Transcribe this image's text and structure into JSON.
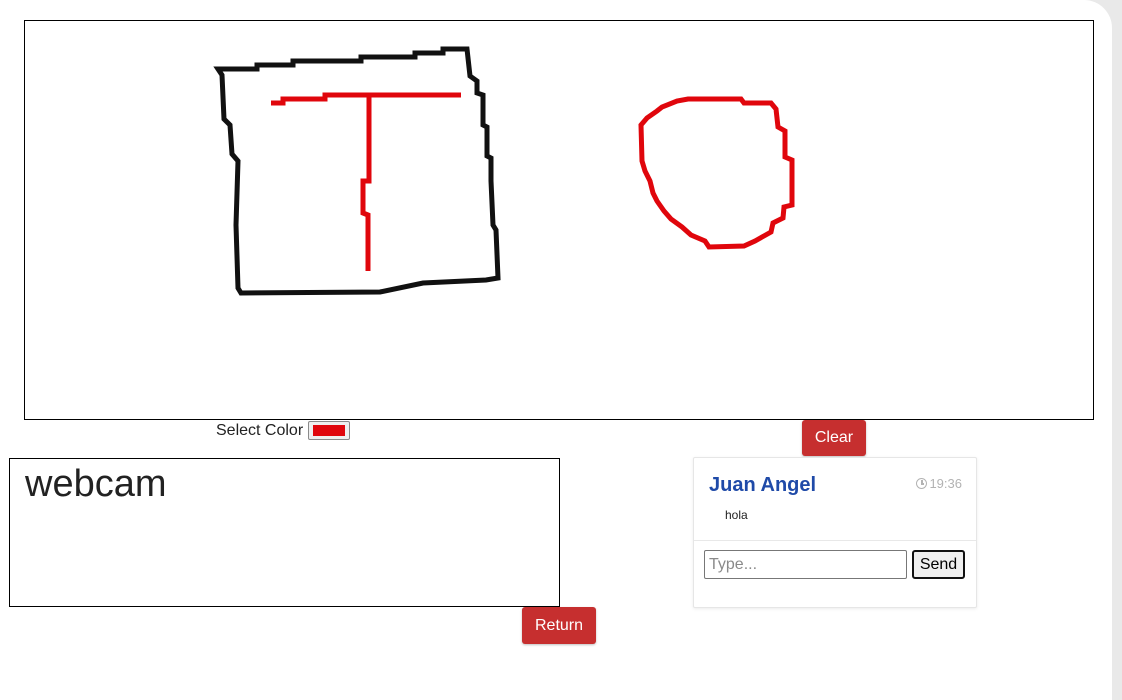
{
  "canvas": {
    "drawing_colors": {
      "black": "#111111",
      "red": "#e0060c"
    }
  },
  "color_picker": {
    "label": "Select Color",
    "value": "#e0060c"
  },
  "buttons": {
    "clear_label": "Clear",
    "return_label": "Return"
  },
  "webcam": {
    "label": "webcam"
  },
  "chat": {
    "messages": [
      {
        "user": "Juan Angel",
        "time": "19:36",
        "text": "hola"
      }
    ],
    "input_placeholder": "Type...",
    "send_label": "Send"
  },
  "colors": {
    "button_red": "#c62f2f",
    "username_blue": "#1f4aa8"
  }
}
